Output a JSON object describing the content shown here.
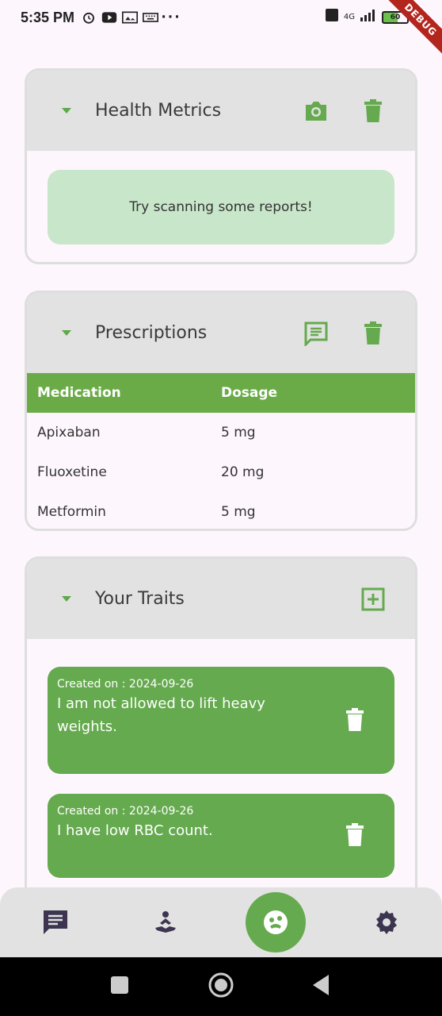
{
  "status": {
    "time": "5:35 PM",
    "battery": "60",
    "network": "4G",
    "debug_label": "DEBUG"
  },
  "health_metrics": {
    "title": "Health Metrics",
    "empty_message": "Try scanning some reports!",
    "icons": [
      "camera-icon",
      "trash-icon"
    ]
  },
  "prescriptions": {
    "title": "Prescriptions",
    "columns": [
      "Medication",
      "Dosage"
    ],
    "rows": [
      {
        "medication": "Apixaban",
        "dosage": "5 mg"
      },
      {
        "medication": "Fluoxetine",
        "dosage": "20 mg"
      },
      {
        "medication": "Metformin",
        "dosage": "5 mg"
      }
    ],
    "icons": [
      "chat-icon",
      "trash-icon"
    ]
  },
  "traits": {
    "title": "Your Traits",
    "items": [
      {
        "date": "Created on : 2024-09-26",
        "text": "I am not allowed to lift heavy weights."
      },
      {
        "date": "Created on : 2024-09-26",
        "text": "I have low RBC count."
      }
    ]
  },
  "nav": {
    "items": [
      "chat-icon",
      "meditation-icon",
      "profile-icon",
      "settings-icon"
    ],
    "active": "profile-icon"
  },
  "colors": {
    "accent": "#65aa4e",
    "header_bg": "#e2e2e2",
    "light_green": "#c8e6c9"
  }
}
